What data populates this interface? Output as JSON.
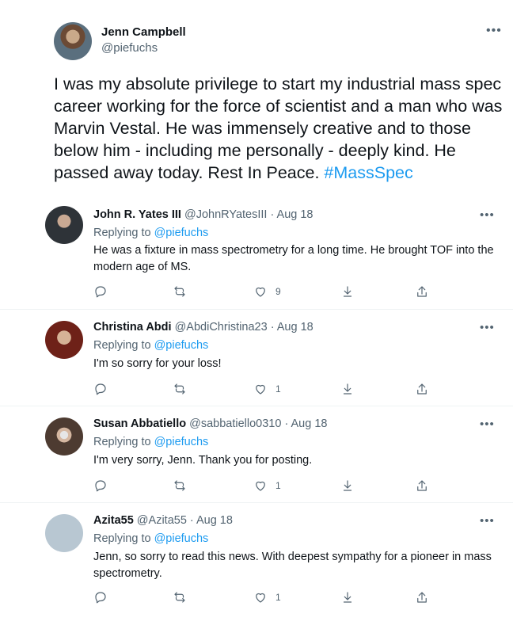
{
  "main_tweet": {
    "author_name": "Jenn Campbell",
    "author_handle": "@piefuchs",
    "more_label": "•••",
    "text": "I was my absolute privilege to start my industrial mass spec career working for the force of scientist and a man who was Marvin Vestal.  He was immensely creative and to those below him - including me personally - deeply kind.  He passed away today.  Rest In Peace. ",
    "hashtag": "#MassSpec"
  },
  "replies": [
    {
      "name": "John R. Yates III",
      "meta": " @JohnRYatesIII · Aug 18",
      "replying_prefix": "Replying to ",
      "replying_handle": "@piefuchs",
      "text": "He was a fixture in mass spectrometry for a long time.  He brought TOF into the modern age of MS.",
      "likes": "9",
      "avatar_color": "#3a3f45"
    },
    {
      "name": "Christina Abdi",
      "meta": " @AbdiChristina23 · Aug 18",
      "replying_prefix": "Replying to ",
      "replying_handle": "@piefuchs",
      "text": "I'm so sorry for your loss!",
      "likes": "1",
      "avatar_color": "#7a2a22"
    },
    {
      "name": "Susan Abbatiello",
      "meta": " @sabbatiello0310 · Aug 18",
      "replying_prefix": "Replying to ",
      "replying_handle": "@piefuchs",
      "text": "I'm very sorry, Jenn. Thank you for posting.",
      "likes": "1",
      "avatar_color": "#5b4a40"
    },
    {
      "name": "Azita55",
      "meta": " @Azita55 · Aug 18",
      "replying_prefix": "Replying to ",
      "replying_handle": "@piefuchs",
      "text": "Jenn, so sorry to read this news.  With deepest sympathy for a pioneer in mass spectrometry.",
      "likes": "1",
      "avatar_color": "#b8c7d2"
    }
  ],
  "more_label": "•••",
  "colors": {
    "link": "#1d9bf0",
    "muted": "#536471",
    "text": "#0f1419"
  },
  "icons": [
    "reply-icon",
    "retweet-icon",
    "like-icon",
    "download-icon",
    "share-icon"
  ]
}
